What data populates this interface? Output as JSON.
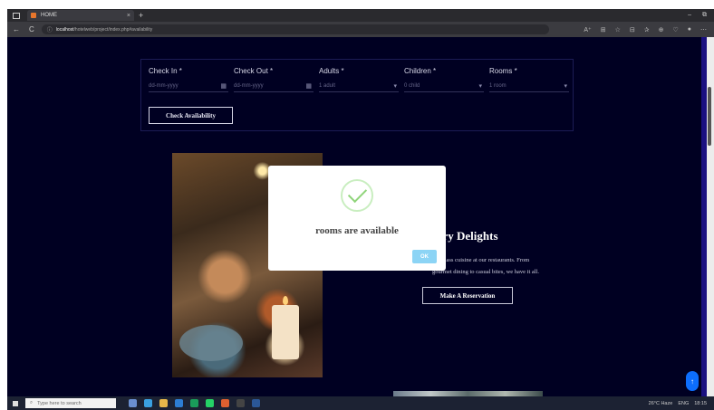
{
  "browser": {
    "tab_title": "HOME",
    "tab_close": "×",
    "new_tab": "+",
    "window_controls": [
      "–",
      "⧉"
    ],
    "nav_buttons": [
      "←",
      "C"
    ],
    "url_host": "localhost",
    "url_path": "/hotelweb/project/index.php#availability",
    "toolbar_icons": [
      "A⁺",
      "⊞",
      "☆",
      "⊟",
      "✰",
      "⊕",
      "♡",
      "●",
      "⋯"
    ]
  },
  "booking": {
    "fields": [
      {
        "label": "Check In *",
        "value": "dd-mm-yyyy",
        "icon": "▦"
      },
      {
        "label": "Check Out *",
        "value": "dd-mm-yyyy",
        "icon": "▦"
      },
      {
        "label": "Adults *",
        "value": "1 adult",
        "icon": "▾"
      },
      {
        "label": "Children *",
        "value": "0 child",
        "icon": "▾"
      },
      {
        "label": "Rooms *",
        "value": "1 room",
        "icon": "▾"
      }
    ],
    "check_button": "Check Availability"
  },
  "section": {
    "title": "ary Delights",
    "text_line1": "class cuisine at our restaurants. From",
    "text_line2": "gourmet dining to casual bites, we have it all.",
    "reserve_button": "Make A Reservation"
  },
  "modal": {
    "message": "rooms are available",
    "ok_button": "OK"
  },
  "fab": {
    "label": "↑"
  },
  "taskbar": {
    "search_placeholder": "Type here to search",
    "weather": "26°C Haze",
    "lang": "ENG",
    "time": "18:15"
  },
  "colors": {
    "page_bg": "#000022",
    "modal_ok": "#8cd4f5",
    "check_green": "#8fd47a",
    "fab_blue": "#0d6efd"
  }
}
